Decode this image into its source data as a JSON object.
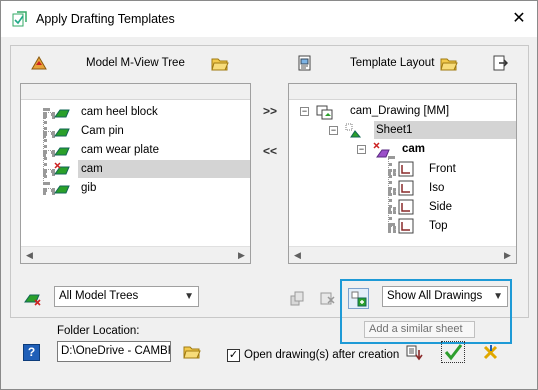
{
  "window": {
    "title": "Apply Drafting Templates",
    "close_glyph": "✕"
  },
  "left_panel": {
    "header": "Model M-View Tree",
    "items": [
      {
        "label": "cam heel block"
      },
      {
        "label": "Cam pin"
      },
      {
        "label": "cam wear plate"
      },
      {
        "label": "cam",
        "selected": true
      },
      {
        "label": "gib"
      }
    ]
  },
  "right_panel": {
    "header": "Template Layout",
    "root": "cam_Drawing [MM]",
    "sheet": "Sheet1",
    "part": "cam",
    "views": [
      "Front",
      "Iso",
      "Side",
      "Top"
    ]
  },
  "transfer": {
    "add": ">>",
    "remove": "<<"
  },
  "model_tree_filter": {
    "selected": "All Model Trees"
  },
  "drawings_filter": {
    "selected": "Show All Drawings"
  },
  "tooltip": "Add a similar sheet",
  "folder": {
    "label": "Folder Location:",
    "value": "D:\\OneDrive - CAMBR"
  },
  "open_drawings": {
    "label": "Open drawing(s) after creation",
    "checked": true
  },
  "help_label": "?",
  "colors": {
    "accent_highlight": "#1e9ad6",
    "selection": "#d4d4d4",
    "ok_green": "#2e9e2e"
  }
}
